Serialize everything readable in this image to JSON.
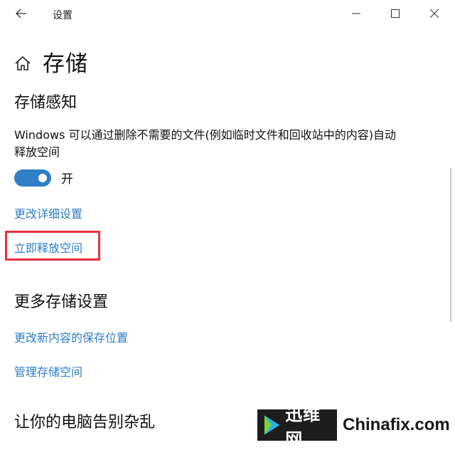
{
  "window": {
    "title": "设置"
  },
  "page": {
    "title": "存储"
  },
  "storage_sense": {
    "heading": "存储感知",
    "description": "Windows 可以通过删除不需要的文件(例如临时文件和回收站中的内容)自动释放空间",
    "toggle_label": "开",
    "toggle_on": true,
    "links": {
      "change_settings": "更改详细设置",
      "free_space_now": "立即释放空间"
    }
  },
  "more_settings": {
    "heading": "更多存储设置",
    "links": {
      "change_save_location": "更改新内容的保存位置",
      "manage_spaces": "管理存储空间"
    }
  },
  "declutter": {
    "heading": "让你的电脑告别杂乱"
  },
  "watermark": {
    "cn": "迅维网",
    "en": "Chinafix.com"
  },
  "colors": {
    "accent": "#2f7ec6",
    "highlight_box": "#e8323c",
    "text": "#111111"
  }
}
